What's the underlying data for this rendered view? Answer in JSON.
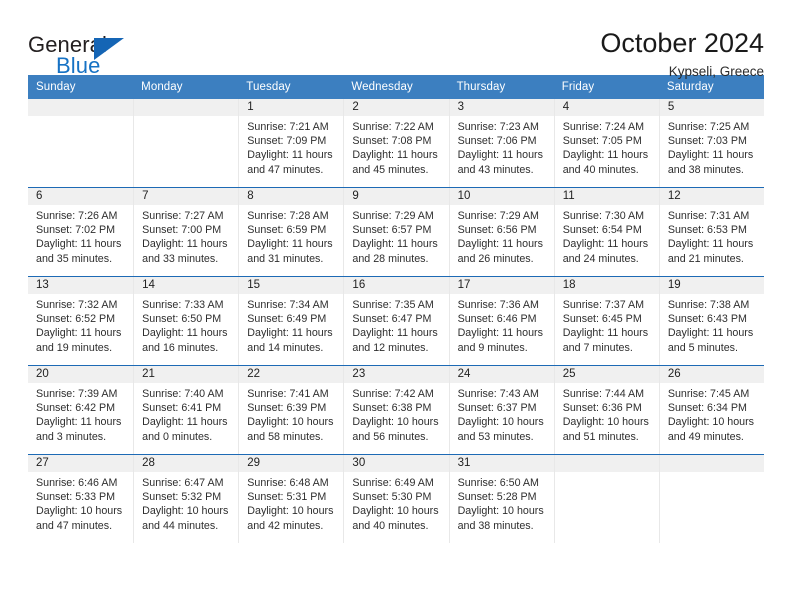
{
  "brand": {
    "name_dark": "General",
    "name_blue": "Blue"
  },
  "header": {
    "title": "October 2024",
    "subtitle": "Kypseli, Greece"
  },
  "weekdays": [
    "Sunday",
    "Monday",
    "Tuesday",
    "Wednesday",
    "Thursday",
    "Friday",
    "Saturday"
  ],
  "colors": {
    "header_blue": "#3c7fc0",
    "row_divider": "#1d6ab5",
    "daynum_band": "#f0f0f0",
    "logo_blue": "#1672c4"
  },
  "weeks": [
    [
      {
        "day": ""
      },
      {
        "day": ""
      },
      {
        "day": "1",
        "sunrise": "Sunrise: 7:21 AM",
        "sunset": "Sunset: 7:09 PM",
        "daylight1": "Daylight: 11 hours",
        "daylight2": "and 47 minutes."
      },
      {
        "day": "2",
        "sunrise": "Sunrise: 7:22 AM",
        "sunset": "Sunset: 7:08 PM",
        "daylight1": "Daylight: 11 hours",
        "daylight2": "and 45 minutes."
      },
      {
        "day": "3",
        "sunrise": "Sunrise: 7:23 AM",
        "sunset": "Sunset: 7:06 PM",
        "daylight1": "Daylight: 11 hours",
        "daylight2": "and 43 minutes."
      },
      {
        "day": "4",
        "sunrise": "Sunrise: 7:24 AM",
        "sunset": "Sunset: 7:05 PM",
        "daylight1": "Daylight: 11 hours",
        "daylight2": "and 40 minutes."
      },
      {
        "day": "5",
        "sunrise": "Sunrise: 7:25 AM",
        "sunset": "Sunset: 7:03 PM",
        "daylight1": "Daylight: 11 hours",
        "daylight2": "and 38 minutes."
      }
    ],
    [
      {
        "day": "6",
        "sunrise": "Sunrise: 7:26 AM",
        "sunset": "Sunset: 7:02 PM",
        "daylight1": "Daylight: 11 hours",
        "daylight2": "and 35 minutes."
      },
      {
        "day": "7",
        "sunrise": "Sunrise: 7:27 AM",
        "sunset": "Sunset: 7:00 PM",
        "daylight1": "Daylight: 11 hours",
        "daylight2": "and 33 minutes."
      },
      {
        "day": "8",
        "sunrise": "Sunrise: 7:28 AM",
        "sunset": "Sunset: 6:59 PM",
        "daylight1": "Daylight: 11 hours",
        "daylight2": "and 31 minutes."
      },
      {
        "day": "9",
        "sunrise": "Sunrise: 7:29 AM",
        "sunset": "Sunset: 6:57 PM",
        "daylight1": "Daylight: 11 hours",
        "daylight2": "and 28 minutes."
      },
      {
        "day": "10",
        "sunrise": "Sunrise: 7:29 AM",
        "sunset": "Sunset: 6:56 PM",
        "daylight1": "Daylight: 11 hours",
        "daylight2": "and 26 minutes."
      },
      {
        "day": "11",
        "sunrise": "Sunrise: 7:30 AM",
        "sunset": "Sunset: 6:54 PM",
        "daylight1": "Daylight: 11 hours",
        "daylight2": "and 24 minutes."
      },
      {
        "day": "12",
        "sunrise": "Sunrise: 7:31 AM",
        "sunset": "Sunset: 6:53 PM",
        "daylight1": "Daylight: 11 hours",
        "daylight2": "and 21 minutes."
      }
    ],
    [
      {
        "day": "13",
        "sunrise": "Sunrise: 7:32 AM",
        "sunset": "Sunset: 6:52 PM",
        "daylight1": "Daylight: 11 hours",
        "daylight2": "and 19 minutes."
      },
      {
        "day": "14",
        "sunrise": "Sunrise: 7:33 AM",
        "sunset": "Sunset: 6:50 PM",
        "daylight1": "Daylight: 11 hours",
        "daylight2": "and 16 minutes."
      },
      {
        "day": "15",
        "sunrise": "Sunrise: 7:34 AM",
        "sunset": "Sunset: 6:49 PM",
        "daylight1": "Daylight: 11 hours",
        "daylight2": "and 14 minutes."
      },
      {
        "day": "16",
        "sunrise": "Sunrise: 7:35 AM",
        "sunset": "Sunset: 6:47 PM",
        "daylight1": "Daylight: 11 hours",
        "daylight2": "and 12 minutes."
      },
      {
        "day": "17",
        "sunrise": "Sunrise: 7:36 AM",
        "sunset": "Sunset: 6:46 PM",
        "daylight1": "Daylight: 11 hours",
        "daylight2": "and 9 minutes."
      },
      {
        "day": "18",
        "sunrise": "Sunrise: 7:37 AM",
        "sunset": "Sunset: 6:45 PM",
        "daylight1": "Daylight: 11 hours",
        "daylight2": "and 7 minutes."
      },
      {
        "day": "19",
        "sunrise": "Sunrise: 7:38 AM",
        "sunset": "Sunset: 6:43 PM",
        "daylight1": "Daylight: 11 hours",
        "daylight2": "and 5 minutes."
      }
    ],
    [
      {
        "day": "20",
        "sunrise": "Sunrise: 7:39 AM",
        "sunset": "Sunset: 6:42 PM",
        "daylight1": "Daylight: 11 hours",
        "daylight2": "and 3 minutes."
      },
      {
        "day": "21",
        "sunrise": "Sunrise: 7:40 AM",
        "sunset": "Sunset: 6:41 PM",
        "daylight1": "Daylight: 11 hours",
        "daylight2": "and 0 minutes."
      },
      {
        "day": "22",
        "sunrise": "Sunrise: 7:41 AM",
        "sunset": "Sunset: 6:39 PM",
        "daylight1": "Daylight: 10 hours",
        "daylight2": "and 58 minutes."
      },
      {
        "day": "23",
        "sunrise": "Sunrise: 7:42 AM",
        "sunset": "Sunset: 6:38 PM",
        "daylight1": "Daylight: 10 hours",
        "daylight2": "and 56 minutes."
      },
      {
        "day": "24",
        "sunrise": "Sunrise: 7:43 AM",
        "sunset": "Sunset: 6:37 PM",
        "daylight1": "Daylight: 10 hours",
        "daylight2": "and 53 minutes."
      },
      {
        "day": "25",
        "sunrise": "Sunrise: 7:44 AM",
        "sunset": "Sunset: 6:36 PM",
        "daylight1": "Daylight: 10 hours",
        "daylight2": "and 51 minutes."
      },
      {
        "day": "26",
        "sunrise": "Sunrise: 7:45 AM",
        "sunset": "Sunset: 6:34 PM",
        "daylight1": "Daylight: 10 hours",
        "daylight2": "and 49 minutes."
      }
    ],
    [
      {
        "day": "27",
        "sunrise": "Sunrise: 6:46 AM",
        "sunset": "Sunset: 5:33 PM",
        "daylight1": "Daylight: 10 hours",
        "daylight2": "and 47 minutes."
      },
      {
        "day": "28",
        "sunrise": "Sunrise: 6:47 AM",
        "sunset": "Sunset: 5:32 PM",
        "daylight1": "Daylight: 10 hours",
        "daylight2": "and 44 minutes."
      },
      {
        "day": "29",
        "sunrise": "Sunrise: 6:48 AM",
        "sunset": "Sunset: 5:31 PM",
        "daylight1": "Daylight: 10 hours",
        "daylight2": "and 42 minutes."
      },
      {
        "day": "30",
        "sunrise": "Sunrise: 6:49 AM",
        "sunset": "Sunset: 5:30 PM",
        "daylight1": "Daylight: 10 hours",
        "daylight2": "and 40 minutes."
      },
      {
        "day": "31",
        "sunrise": "Sunrise: 6:50 AM",
        "sunset": "Sunset: 5:28 PM",
        "daylight1": "Daylight: 10 hours",
        "daylight2": "and 38 minutes."
      },
      {
        "day": ""
      },
      {
        "day": ""
      }
    ]
  ]
}
